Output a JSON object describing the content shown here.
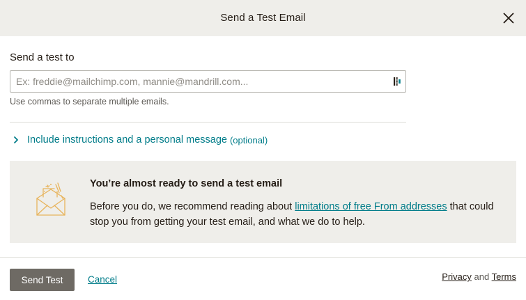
{
  "header": {
    "title": "Send a Test Email"
  },
  "form": {
    "label": "Send a test to",
    "email_value": "",
    "email_placeholder": "Ex: freddie@mailchimp.com, mannie@mandrill.com...",
    "help_text": "Use commas to separate multiple emails."
  },
  "expander": {
    "label": "Include instructions and a personal message",
    "optional": "(optional)"
  },
  "notice": {
    "title": "You’re almost ready to send a test email",
    "body_before": "Before you do, we recommend reading about ",
    "link_text": "limitations of free From addresses",
    "body_after": " that could stop you from getting your test email, and what we do to help."
  },
  "footer": {
    "send_label": "Send Test",
    "cancel_label": "Cancel",
    "privacy_label": "Privacy",
    "and_text": "and",
    "terms_label": "Terms"
  },
  "colors": {
    "accent": "#007c89",
    "header_bg": "#efeeea",
    "button_bg": "#6e6a64",
    "icon_gold": "#e8b45c"
  },
  "icons": {
    "close": "close-icon",
    "contacts": "contacts-icon",
    "chevron": "chevron-right-icon",
    "envelope": "envelope-icon"
  }
}
